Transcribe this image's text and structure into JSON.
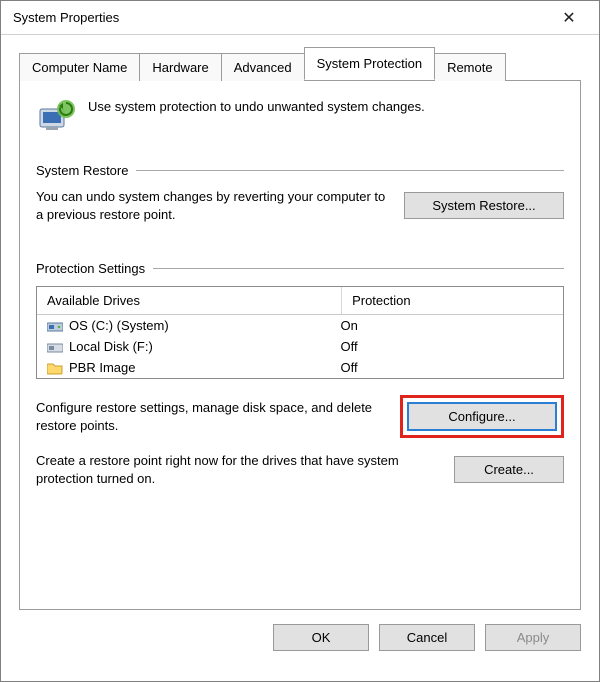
{
  "window": {
    "title": "System Properties"
  },
  "tabs": {
    "computer_name": "Computer Name",
    "hardware": "Hardware",
    "advanced": "Advanced",
    "system_protection": "System Protection",
    "remote": "Remote"
  },
  "intro": {
    "text": "Use system protection to undo unwanted system changes."
  },
  "groups": {
    "restore_label": "System Restore",
    "restore_desc": "You can undo system changes by reverting your computer to a previous restore point.",
    "restore_btn": "System Restore...",
    "protection_label": "Protection Settings",
    "table_headers": {
      "drives": "Available Drives",
      "protection": "Protection"
    },
    "drives": [
      {
        "name": "OS (C:) (System)",
        "protection": "On",
        "icon": "hdd-os"
      },
      {
        "name": "Local Disk (F:)",
        "protection": "Off",
        "icon": "hdd"
      },
      {
        "name": "PBR Image",
        "protection": "Off",
        "icon": "folder"
      }
    ],
    "configure_desc": "Configure restore settings, manage disk space, and delete restore points.",
    "configure_btn": "Configure...",
    "create_desc": "Create a restore point right now for the drives that have system protection turned on.",
    "create_btn": "Create..."
  },
  "buttons": {
    "ok": "OK",
    "cancel": "Cancel",
    "apply": "Apply"
  }
}
